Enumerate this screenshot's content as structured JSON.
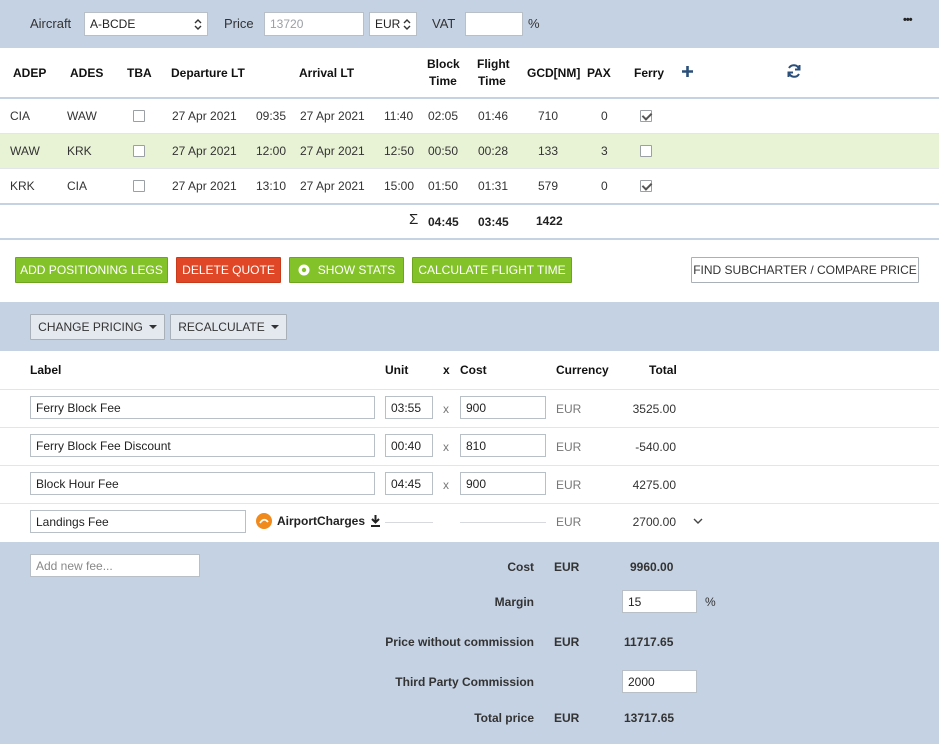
{
  "top": {
    "aircraft_label": "Aircraft",
    "aircraft_value": "A-BCDE",
    "price_label": "Price",
    "price_placeholder": "13720",
    "currency": "EUR",
    "vat_label": "VAT",
    "vat_value": "",
    "vat_unit": "%",
    "more": "•••"
  },
  "legs": {
    "headers": {
      "adep": "ADEP",
      "ades": "ADES",
      "tba": "TBA",
      "departure": "Departure LT",
      "arrival": "Arrival LT",
      "block1": "Block",
      "block2": "Time",
      "flight1": "Flight",
      "flight2": "Time",
      "gcd": "GCD[NM]",
      "pax": "PAX",
      "ferry": "Ferry"
    },
    "rows": [
      {
        "adep": "CIA",
        "ades": "WAW",
        "tba": false,
        "dep_date": "27 Apr 2021",
        "dep_time": "09:35",
        "arr_date": "27 Apr 2021",
        "arr_time": "11:40",
        "block": "02:05",
        "flight": "01:46",
        "gcd": "710",
        "pax": "0",
        "ferry": true
      },
      {
        "adep": "WAW",
        "ades": "KRK",
        "tba": false,
        "dep_date": "27 Apr 2021",
        "dep_time": "12:00",
        "arr_date": "27 Apr 2021",
        "arr_time": "12:50",
        "block": "00:50",
        "flight": "00:28",
        "gcd": "133",
        "pax": "3",
        "ferry": false
      },
      {
        "adep": "KRK",
        "ades": "CIA",
        "tba": false,
        "dep_date": "27 Apr 2021",
        "dep_time": "13:10",
        "arr_date": "27 Apr 2021",
        "arr_time": "15:00",
        "block": "01:50",
        "flight": "01:31",
        "gcd": "579",
        "pax": "0",
        "ferry": true
      }
    ],
    "totals": {
      "sigma": "Σ",
      "block": "04:45",
      "flight": "03:45",
      "gcd": "1422"
    }
  },
  "actions": {
    "add_positioning": "ADD POSITIONING LEGS",
    "delete_quote": "DELETE QUOTE",
    "show_stats": "SHOW STATS",
    "calculate": "CALCULATE FLIGHT TIME",
    "subcharter": "FIND SUBCHARTER / COMPARE PRICE"
  },
  "pricing": {
    "change_pricing": "CHANGE PRICING",
    "recalculate": "RECALCULATE",
    "headers": {
      "label": "Label",
      "unit": "Unit",
      "x": "x",
      "cost": "Cost",
      "currency": "Currency",
      "total": "Total"
    },
    "fees": [
      {
        "label": "Ferry Block Fee",
        "unit": "03:55",
        "x": "x",
        "cost": "900",
        "currency": "EUR",
        "total": "3525.00"
      },
      {
        "label": "Ferry Block Fee Discount",
        "unit": "00:40",
        "x": "x",
        "cost": "810",
        "currency": "EUR",
        "total": "-540.00"
      },
      {
        "label": "Block Hour Fee",
        "unit": "04:45",
        "x": "x",
        "cost": "900",
        "currency": "EUR",
        "total": "4275.00"
      }
    ],
    "landing": {
      "label": "Landings Fee",
      "provider": "AirportCharges",
      "currency": "EUR",
      "total": "2700.00"
    }
  },
  "summary": {
    "add_fee_placeholder": "Add new fee...",
    "cost_label": "Cost",
    "cost_currency": "EUR",
    "cost_value": "9960.00",
    "margin_label": "Margin",
    "margin_value": "15",
    "margin_unit": "%",
    "pwc_label": "Price without commission",
    "pwc_currency": "EUR",
    "pwc_value": "11717.65",
    "tpc_label": "Third Party Commission",
    "tpc_value": "2000",
    "total_label": "Total price",
    "total_currency": "EUR",
    "total_value": "13717.65"
  },
  "colors": {
    "topbar": "#c5d2e3",
    "highlight_row": "#e8f3d6",
    "green": "#84c22a",
    "red": "#e04726",
    "accent": "#2a4f7a"
  }
}
